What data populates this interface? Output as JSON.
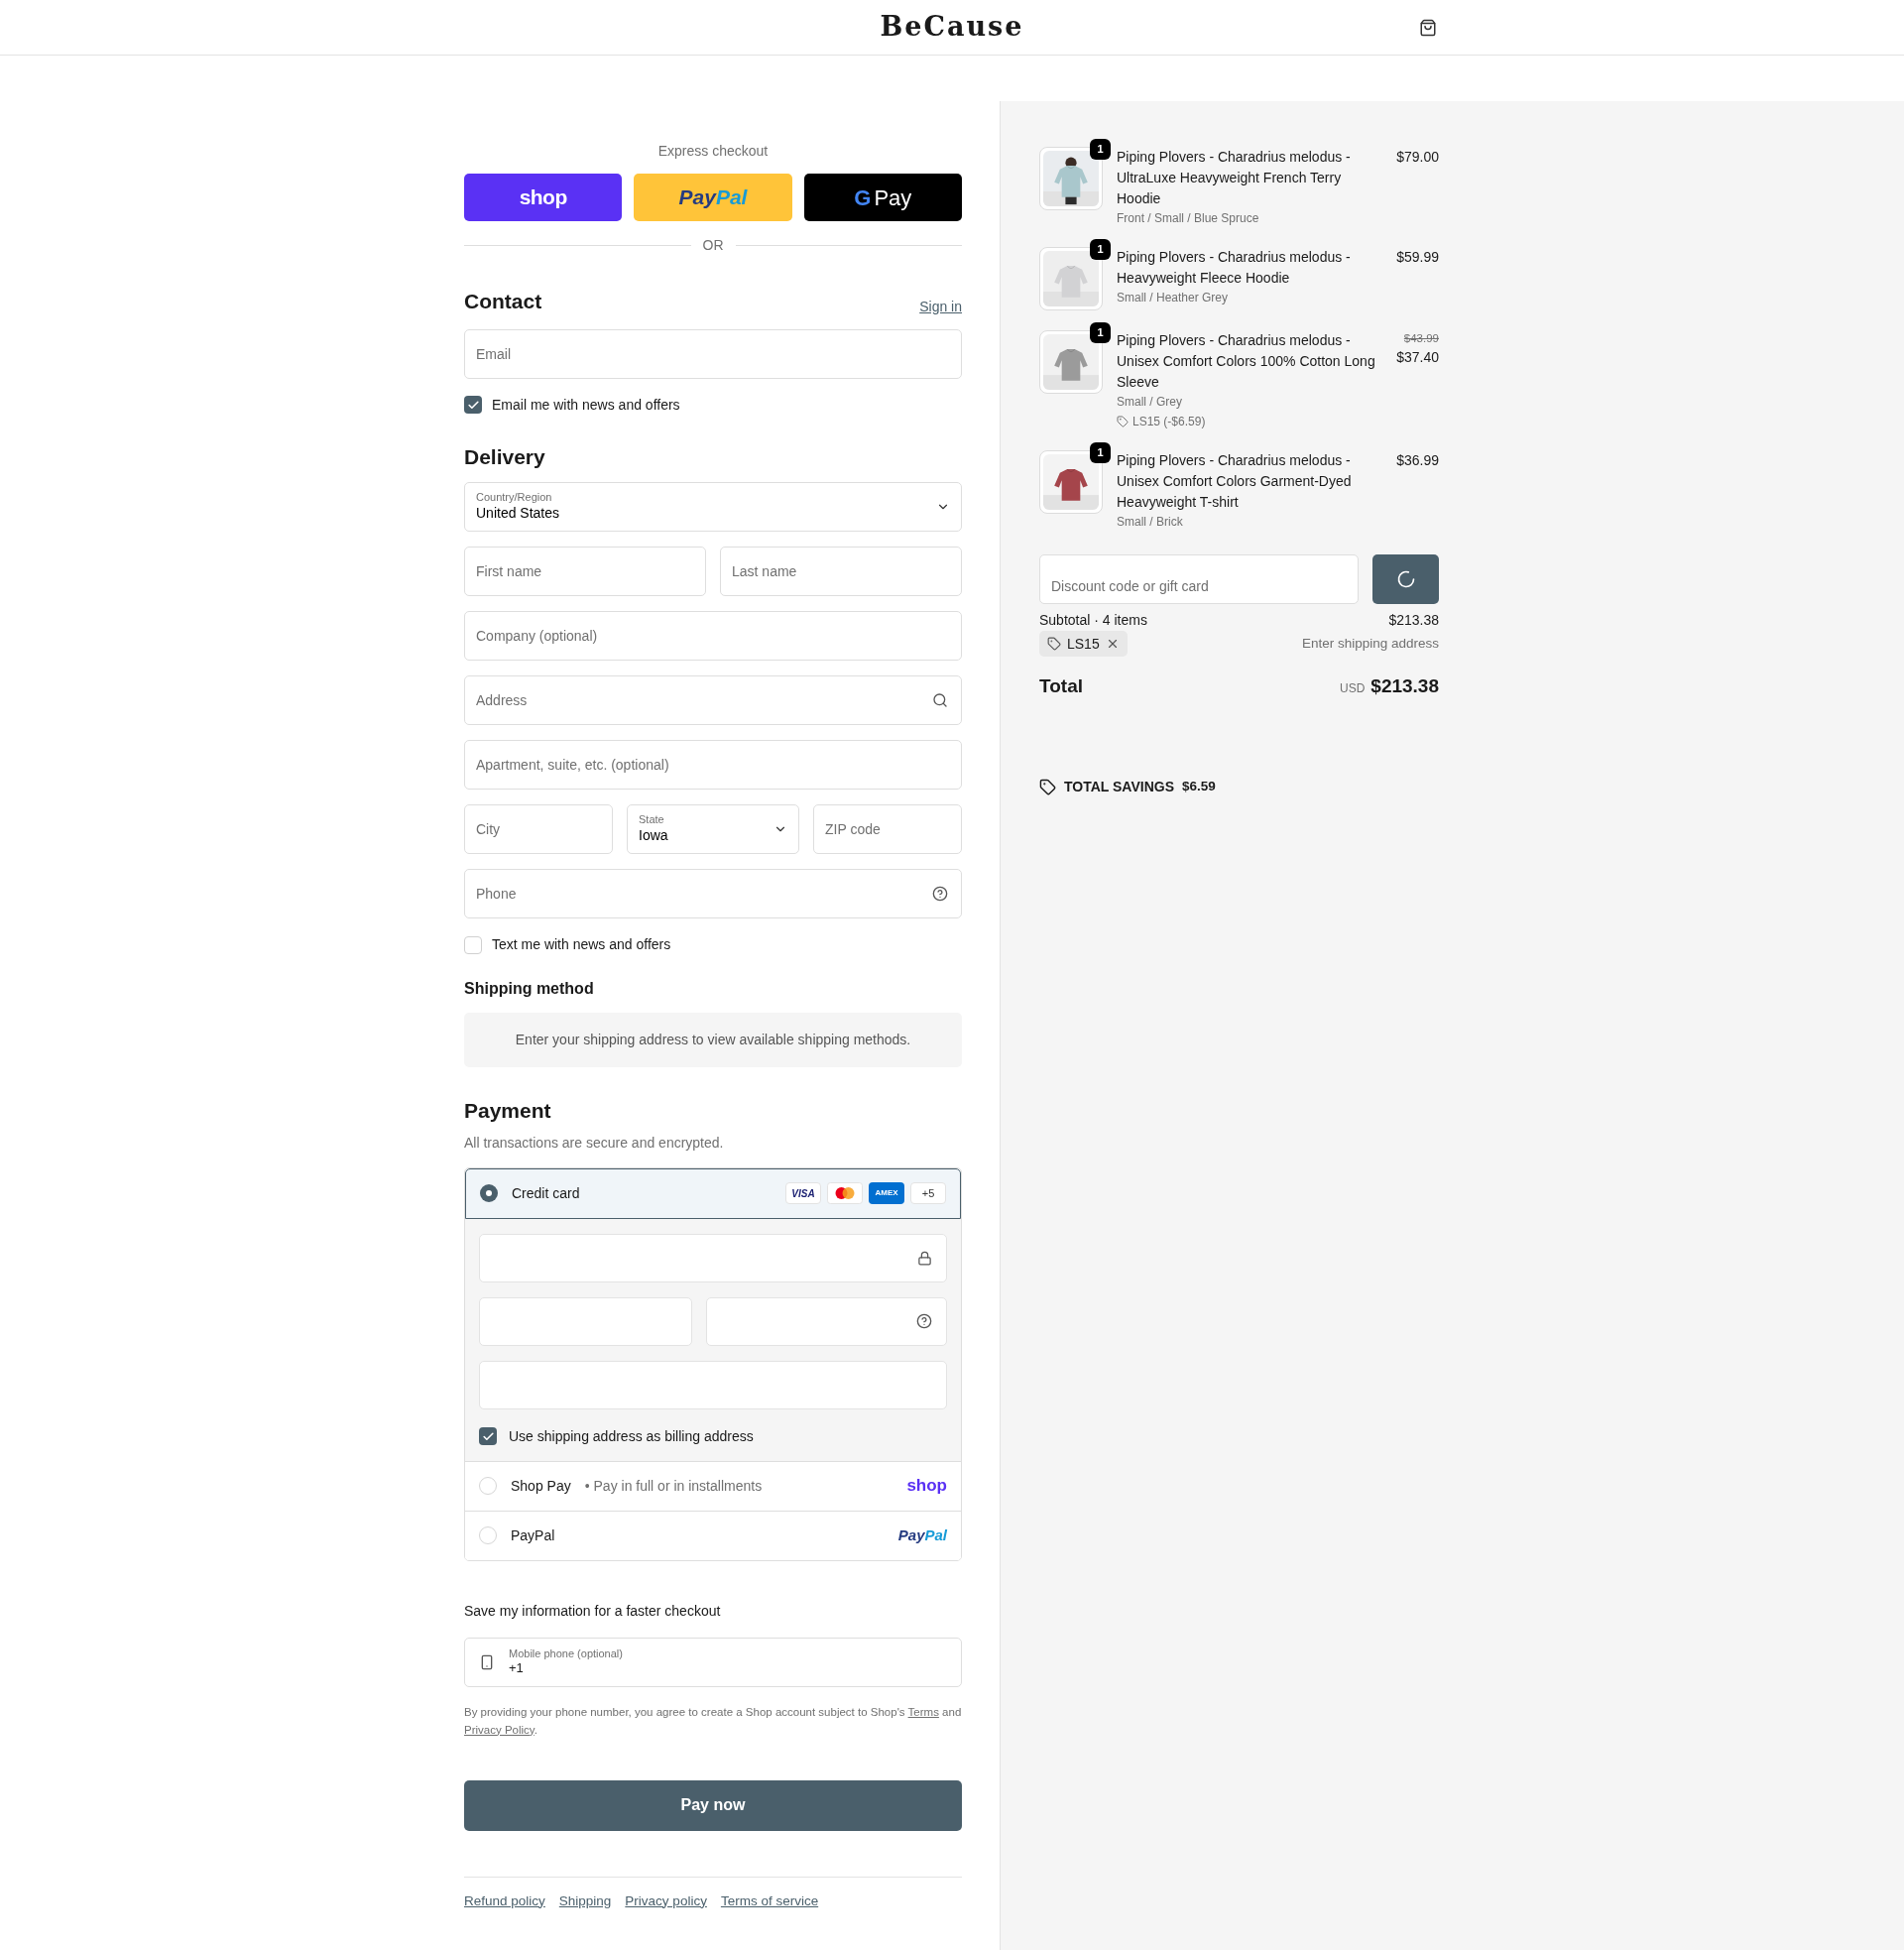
{
  "header": {
    "logo": "BeCause"
  },
  "express_checkout": {
    "title": "Express checkout",
    "buttons": [
      {
        "kind": "shop",
        "label": "shop"
      },
      {
        "kind": "paypal",
        "parts": [
          "Pay",
          "Pal"
        ]
      },
      {
        "kind": "gpay",
        "mark": "G",
        "label": "Pay"
      }
    ],
    "divider": "OR"
  },
  "contact": {
    "title": "Contact",
    "sign_in": "Sign in",
    "email": {
      "placeholder": "Email"
    },
    "news": {
      "label": "Email me with news and offers",
      "checked": true
    }
  },
  "delivery": {
    "title": "Delivery",
    "rows": [
      [
        {
          "kind": "select",
          "label": "Country/Region",
          "value": "United States"
        }
      ],
      [
        {
          "kind": "input",
          "placeholder": "First name"
        },
        {
          "kind": "input",
          "placeholder": "Last name"
        }
      ],
      [
        {
          "kind": "input",
          "placeholder": "Company (optional)"
        }
      ],
      [
        {
          "kind": "search_input",
          "placeholder": "Address"
        }
      ],
      [
        {
          "kind": "input",
          "placeholder": "Apartment, suite, etc. (optional)"
        }
      ],
      [
        {
          "kind": "input",
          "placeholder": "City"
        },
        {
          "kind": "select",
          "label": "State",
          "value": "Iowa"
        },
        {
          "kind": "input",
          "placeholder": "ZIP code"
        }
      ],
      [
        {
          "kind": "help_input",
          "placeholder": "Phone"
        }
      ]
    ],
    "sms": {
      "label": "Text me with news and offers",
      "checked": false
    }
  },
  "shipping_method": {
    "title": "Shipping method",
    "notice": "Enter your shipping address to view available shipping methods."
  },
  "payment": {
    "title": "Payment",
    "subtitle": "All transactions are secure and encrypted.",
    "methods": [
      {
        "kind": "card",
        "label": "Credit card",
        "selected": true,
        "brands": [
          {
            "kind": "visa",
            "label": "VISA"
          },
          {
            "kind": "mastercard"
          },
          {
            "kind": "amex",
            "label": "AMEX"
          },
          {
            "kind": "more",
            "label": "+5"
          }
        ],
        "billing": {
          "label": "Use shipping address as billing address",
          "checked": true
        }
      },
      {
        "kind": "shop_pay",
        "label": "Shop Pay",
        "separator": "•",
        "detail": "Pay in full or in installments",
        "logo": "shop",
        "selected": false
      },
      {
        "kind": "paypal",
        "label": "PayPal",
        "logo_parts": [
          "Pay",
          "Pal"
        ],
        "selected": false
      }
    ]
  },
  "save_info": {
    "title": "Save my information for a faster checkout",
    "phone": {
      "label": "Mobile phone (optional)",
      "value": "+1"
    },
    "legal": {
      "text": "By providing your phone number, you agree to create a Shop account subject to Shop's",
      "terms": "Terms",
      "and": "and",
      "privacy": "Privacy Policy",
      "end": "."
    }
  },
  "pay_button": "Pay now",
  "footer_links": [
    "Refund policy",
    "Shipping",
    "Privacy policy",
    "Terms of service"
  ],
  "summary": {
    "items": [
      {
        "quantity": "1",
        "name": "Piping Plovers - Charadrius melodus - UltraLuxe Heavyweight French Terry Hoodie",
        "variant": "Front / Small / Blue Spruce",
        "price": "$79.00"
      },
      {
        "quantity": "1",
        "name": "Piping Plovers - Charadrius melodus - Heavyweight Fleece Hoodie",
        "variant": "Small / Heather Grey",
        "price": "$59.99"
      },
      {
        "quantity": "1",
        "name": "Piping Plovers - Charadrius melodus - Unisex Comfort Colors 100% Cotton Long Sleeve",
        "variant": "Small / Grey",
        "discount": "LS15 (-$6.59)",
        "compare_price": "$43.99",
        "price": "$37.40"
      },
      {
        "quantity": "1",
        "name": "Piping Plovers - Charadrius melodus - Unisex Comfort Colors Garment-Dyed Heavyweight T-shirt",
        "variant": "Small / Brick",
        "price": "$36.99"
      }
    ],
    "discount_field": {
      "placeholder": "Discount code or gift card"
    },
    "subtotal": {
      "label": "Subtotal · 4 items",
      "value": "$213.38"
    },
    "applied_code": "LS15",
    "shipping": {
      "value": "Enter shipping address"
    },
    "total": {
      "label": "Total",
      "currency": "USD",
      "value": "$213.38"
    },
    "savings": {
      "label": "TOTAL SAVINGS",
      "value": "$6.59"
    }
  }
}
